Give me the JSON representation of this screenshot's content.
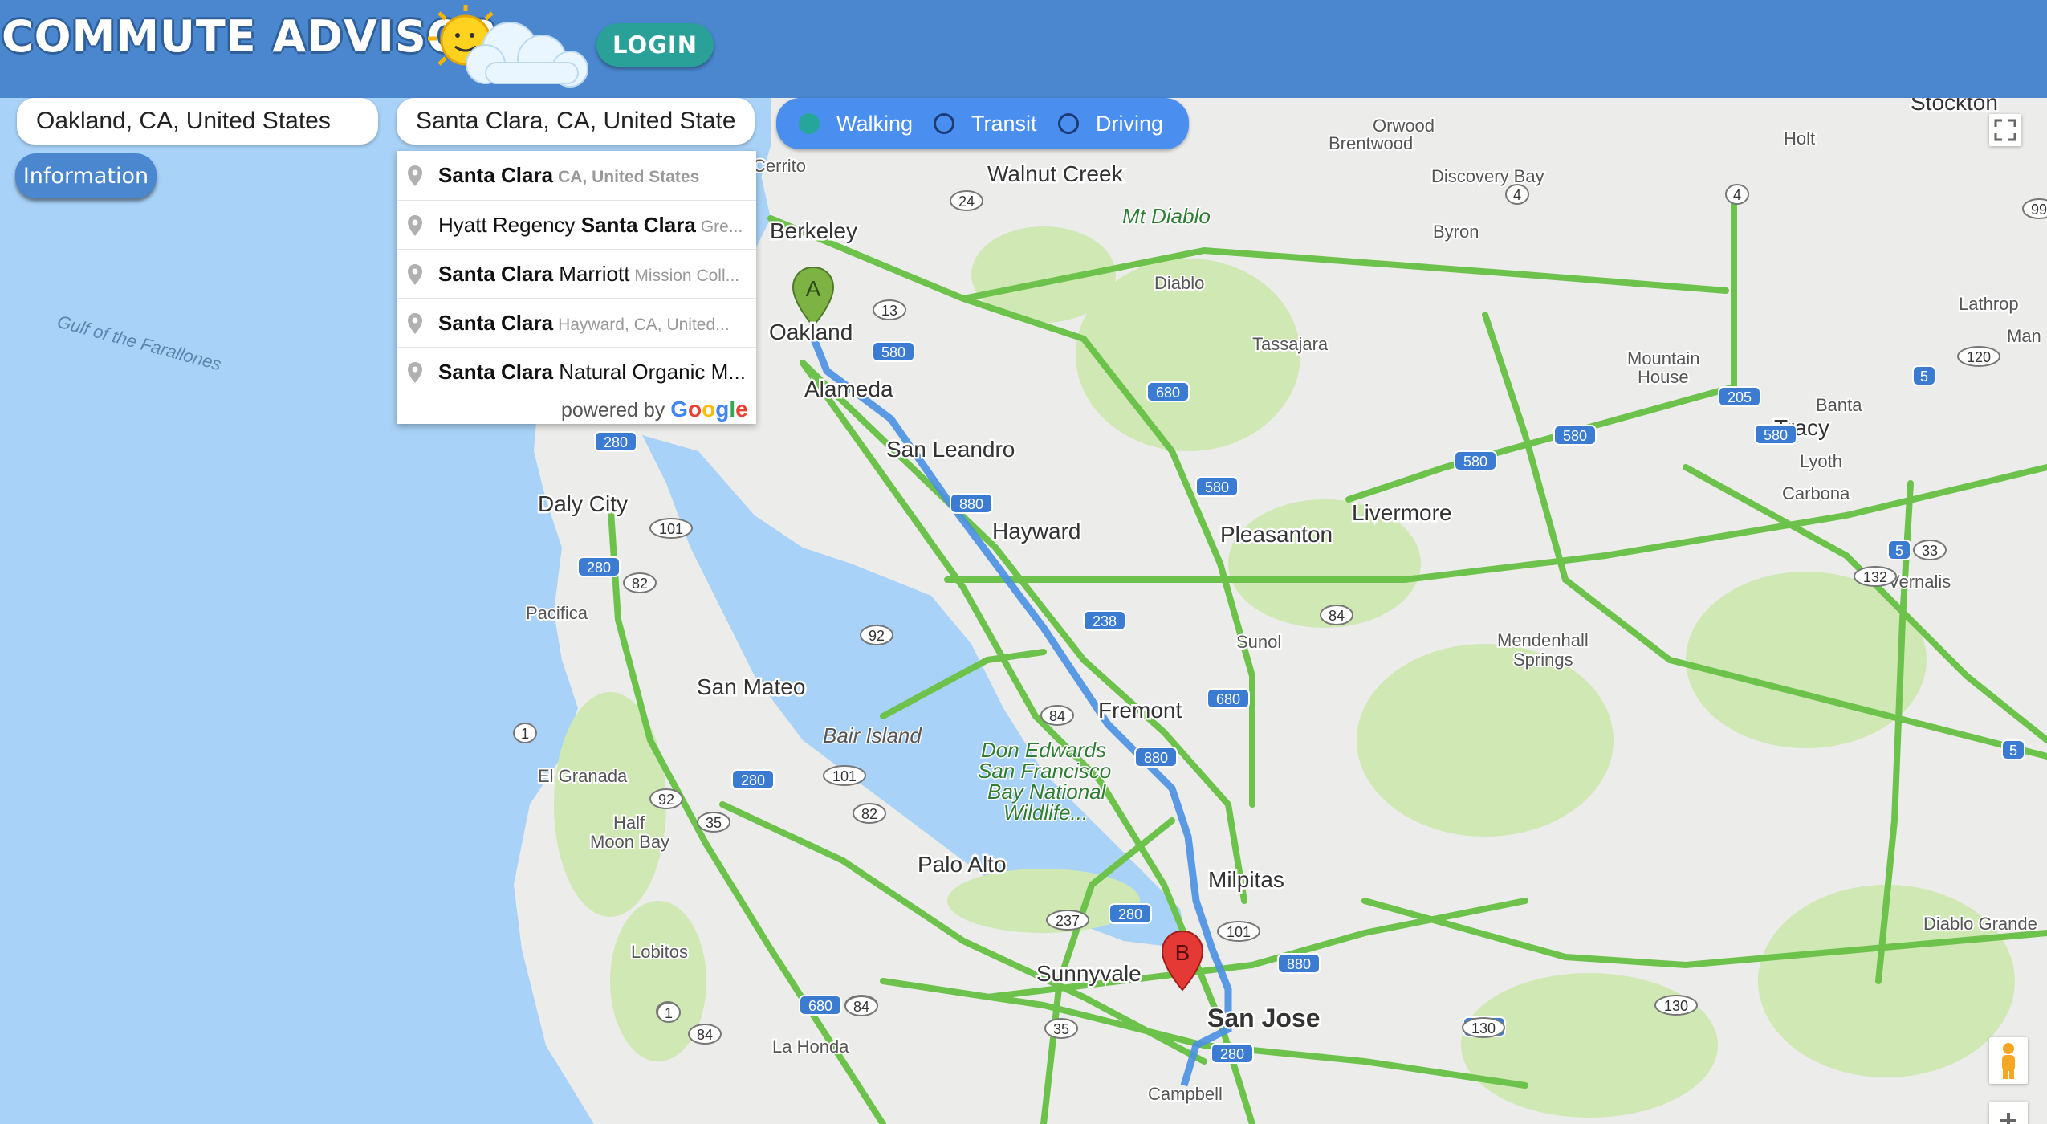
{
  "header": {
    "app_title": "COMMUTE ADVISOR",
    "login_label": "LOGIN",
    "weather_icon": "sun-cloud-icon"
  },
  "search": {
    "origin_value": "Oakland, CA, United States",
    "destination_value": "Santa Clara, CA, United States"
  },
  "modes": {
    "selected": "Walking",
    "options": [
      "Walking",
      "Transit",
      "Driving"
    ]
  },
  "info_button_label": "Information",
  "autocomplete": {
    "items": [
      {
        "main_bold": "Santa Clara",
        "main_rest": "",
        "secondary": "CA, United States"
      },
      {
        "main_pre": "Hyatt Regency ",
        "main_bold": "Santa Clara",
        "secondary": "Gre..."
      },
      {
        "main_bold": "Santa Clara",
        "main_rest": " Marriott",
        "secondary": "Mission Coll..."
      },
      {
        "main_bold": "Santa Clara",
        "main_rest": "",
        "secondary": "Hayward, CA, United..."
      },
      {
        "main_bold": "Santa Clara",
        "main_rest": " Natural Organic M...",
        "secondary": ""
      }
    ],
    "powered_by": "powered by",
    "brand": "Google"
  },
  "map": {
    "markers": [
      {
        "label": "A",
        "color": "#7cb342"
      },
      {
        "label": "B",
        "color": "#e53935"
      }
    ],
    "places": {
      "stockton": "Stockton",
      "orwood": "Orwood",
      "brentwood": "Brentwood",
      "holt": "Holt",
      "discovery_bay": "Discovery Bay",
      "byron": "Byron",
      "walnut_creek": "Walnut Creek",
      "mt_diablo": "Mt Diablo",
      "diablo": "Diablo",
      "berkeley": "Berkeley",
      "cerrito": "Cerrito",
      "oakland": "Oakland",
      "alameda": "Alameda",
      "tassajara": "Tassajara",
      "lathrop": "Lathrop",
      "manteca": "Man",
      "mountain_house": "Mountain",
      "mountain_house_2": "House",
      "banta": "Banta",
      "tracy": "Tracy",
      "lyoth": "Lyoth",
      "carbona": "Carbona",
      "gulf": "Gulf of the Farallones",
      "san_leandro": "San Leandro",
      "hayward": "Hayward",
      "pleasanton": "Pleasanton",
      "livermore": "Livermore",
      "daly_city": "Daly City",
      "pacifica": "Pacifica",
      "vernalis": "Vernalis",
      "sunol": "Sunol",
      "mendenhall": "Mendenhall",
      "mendenhall_2": "Springs",
      "san_mateo": "San Mateo",
      "fremont": "Fremont",
      "bair_island": "Bair Island",
      "el_granada": "El Granada",
      "half_moon": "Half",
      "half_moon_2": "Moon Bay",
      "don_edwards_1": "Don Edwards",
      "don_edwards_2": "San Francisco",
      "don_edwards_3": "Bay National",
      "don_edwards_4": "Wildlife...",
      "palo_alto": "Palo Alto",
      "milpitas": "Milpitas",
      "diablo_grande": "Diablo Grande",
      "lobitos": "Lobitos",
      "sunnyvale": "Sunnyvale",
      "san_jose": "San Jose",
      "la_honda": "La Honda",
      "campbell": "Campbell"
    },
    "shields": [
      "24",
      "4",
      "4",
      "13",
      "580",
      "680",
      "580",
      "580",
      "205",
      "580",
      "580",
      "5",
      "120",
      "280",
      "101",
      "280",
      "82",
      "880",
      "84",
      "92",
      "238",
      "680",
      "84",
      "880",
      "280",
      "101",
      "82",
      "92",
      "35",
      "1",
      "1",
      "35",
      "280",
      "237",
      "101",
      "880",
      "680",
      "84",
      "35",
      "280",
      "280",
      "130",
      "130",
      "1",
      "84",
      "5",
      "33",
      "132",
      "5",
      "99"
    ]
  },
  "colors": {
    "header": "#4a87cf",
    "accent": "#26a69a",
    "route": "#4a90e2",
    "traffic": "#6cc24a"
  }
}
